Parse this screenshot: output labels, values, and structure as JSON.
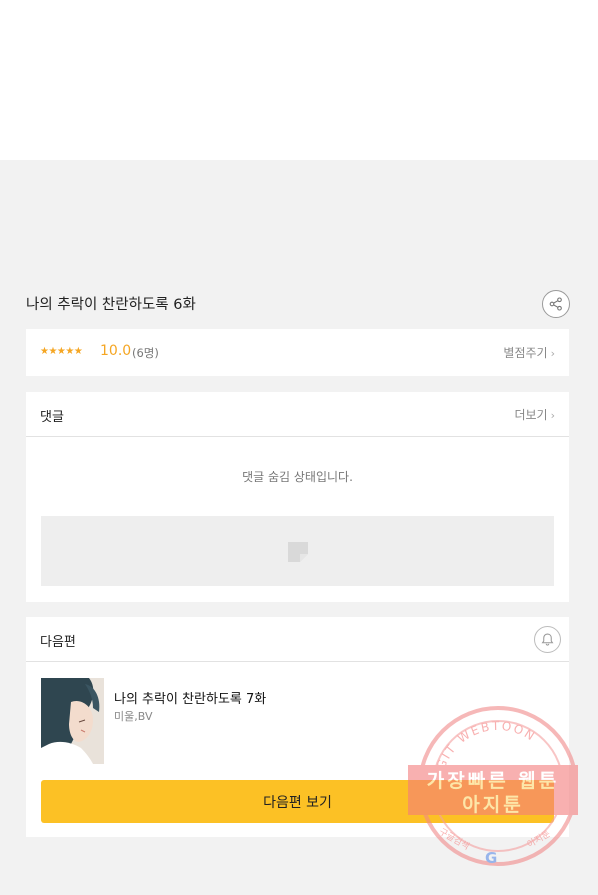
{
  "episode": {
    "title": "나의 추락이 찬란하도록 6화",
    "share_icon": "share-icon"
  },
  "rating": {
    "stars": "★★★★★",
    "score": "10.0",
    "count": "(6명)",
    "rate_label": "별점주기",
    "chevron": "›"
  },
  "comments": {
    "title": "댓글",
    "more_label": "더보기",
    "chevron": "›",
    "hidden_message": "댓글 숨김 상태입니다."
  },
  "next": {
    "title": "다음편",
    "bell_icon": "bell-icon",
    "episode_title": "나의 추락이 찬란하도록 7화",
    "author": "미울,BV",
    "button_label": "다음편 보기"
  },
  "watermark": {
    "arc_text": "AGIT WEBTOON",
    "line1": "가장빠른 웹툰",
    "line2": "아지툰",
    "bottom_left": "구글검색",
    "bottom_right": "아지툰",
    "g_letter": "G"
  },
  "colors": {
    "star": "#f5a623",
    "button": "#fcc125",
    "background": "#f2f2f2"
  }
}
